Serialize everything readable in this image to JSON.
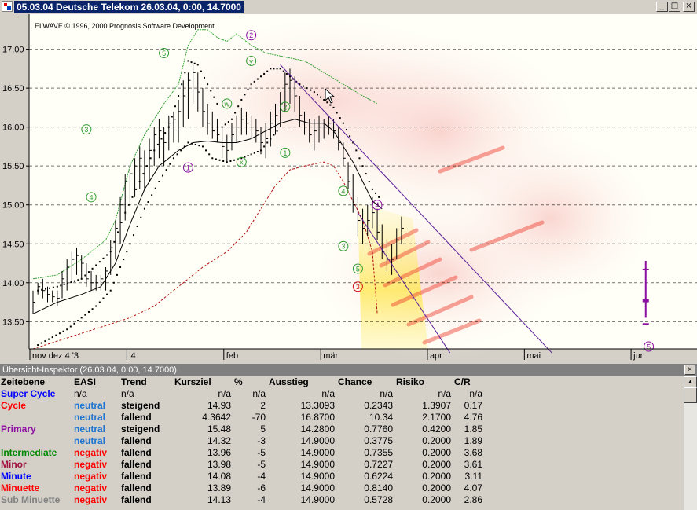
{
  "window": {
    "title": "05.03.04  Deutsche Telekom  26.03.04, 0:00, 14.7000",
    "minimize_glyph": "_",
    "maximize_glyph": "□",
    "close_glyph": "×"
  },
  "chart": {
    "copyright": "ELWAVE © 1996, 2000 Prognosis Software Development",
    "background": "#fffff7",
    "ylim": [
      13.15,
      17.45
    ],
    "y_ticks": [
      "17.00",
      "16.50",
      "16.00",
      "15.50",
      "15.00",
      "14.50",
      "14.00",
      "13.50"
    ],
    "y_tick_values": [
      17.0,
      16.5,
      16.0,
      15.5,
      15.0,
      14.5,
      14.0,
      13.5
    ],
    "x_labels": [
      {
        "label": "nov dez 4 '3",
        "day": 0
      },
      {
        "label": "'4",
        "day": 20
      },
      {
        "label": "feb",
        "day": 40
      },
      {
        "label": "mär",
        "day": 60
      },
      {
        "label": "apr",
        "day": 82
      },
      {
        "label": "mai",
        "day": 102
      },
      {
        "label": "jun",
        "day": 124
      }
    ],
    "candles": [
      [
        13.6,
        13.9,
        13.75
      ],
      [
        13.85,
        14.0,
        13.95
      ],
      [
        13.8,
        14.05,
        13.9
      ],
      [
        13.75,
        13.95,
        13.85
      ],
      [
        13.75,
        13.9,
        13.82
      ],
      [
        13.7,
        13.9,
        13.8
      ],
      [
        13.8,
        14.15,
        14.05
      ],
      [
        13.9,
        14.3,
        14.2
      ],
      [
        14.0,
        14.4,
        14.3
      ],
      [
        14.1,
        14.45,
        14.35
      ],
      [
        14.05,
        14.35,
        14.25
      ],
      [
        13.95,
        14.25,
        14.05
      ],
      [
        13.9,
        14.15,
        14.0
      ],
      [
        13.9,
        14.1,
        14.0
      ],
      [
        13.9,
        14.1,
        14.05
      ],
      [
        13.9,
        14.2,
        14.15
      ],
      [
        14.1,
        14.55,
        14.45
      ],
      [
        14.3,
        14.8,
        14.7
      ],
      [
        14.5,
        15.1,
        15.0
      ],
      [
        14.8,
        15.4,
        15.3
      ],
      [
        15.0,
        15.5,
        15.4
      ],
      [
        15.1,
        15.6,
        15.5
      ],
      [
        15.2,
        15.75,
        15.6
      ],
      [
        15.2,
        15.7,
        15.5
      ],
      [
        15.3,
        15.85,
        15.7
      ],
      [
        15.5,
        16.0,
        15.9
      ],
      [
        15.6,
        16.1,
        15.95
      ],
      [
        15.5,
        16.0,
        15.8
      ],
      [
        15.7,
        16.15,
        16.05
      ],
      [
        15.8,
        16.2,
        16.1
      ],
      [
        15.8,
        16.35,
        16.2
      ],
      [
        16.0,
        16.6,
        16.4
      ],
      [
        16.1,
        16.7,
        16.6
      ],
      [
        16.3,
        16.8,
        16.7
      ],
      [
        16.2,
        16.7,
        16.45
      ],
      [
        16.0,
        16.5,
        16.2
      ],
      [
        15.9,
        16.3,
        16.05
      ],
      [
        15.85,
        16.2,
        15.95
      ],
      [
        15.8,
        16.1,
        15.9
      ],
      [
        15.6,
        16.0,
        15.75
      ],
      [
        15.55,
        15.9,
        15.7
      ],
      [
        15.7,
        16.05,
        15.9
      ],
      [
        15.8,
        16.15,
        16.0
      ],
      [
        15.9,
        16.25,
        16.1
      ],
      [
        15.9,
        16.2,
        16.05
      ],
      [
        15.85,
        16.15,
        16.0
      ],
      [
        15.8,
        16.1,
        15.95
      ],
      [
        15.65,
        16.0,
        15.8
      ],
      [
        15.6,
        16.05,
        15.85
      ],
      [
        15.75,
        16.2,
        16.05
      ],
      [
        15.9,
        16.3,
        16.15
      ],
      [
        16.0,
        16.45,
        16.3
      ],
      [
        16.2,
        16.7,
        16.55
      ],
      [
        16.3,
        16.75,
        16.6
      ],
      [
        16.2,
        16.65,
        16.4
      ],
      [
        16.0,
        16.4,
        16.15
      ],
      [
        15.9,
        16.2,
        16.0
      ],
      [
        15.8,
        16.1,
        15.9
      ],
      [
        15.7,
        16.1,
        15.95
      ],
      [
        15.8,
        16.15,
        16.0
      ],
      [
        15.85,
        16.1,
        16.0
      ],
      [
        15.9,
        16.15,
        16.05
      ],
      [
        15.85,
        16.1,
        15.95
      ],
      [
        15.7,
        16.0,
        15.8
      ],
      [
        15.5,
        15.8,
        15.6
      ],
      [
        15.2,
        15.55,
        15.3
      ],
      [
        14.9,
        15.4,
        15.0
      ],
      [
        14.6,
        15.1,
        14.8
      ],
      [
        14.5,
        14.95,
        14.7
      ],
      [
        14.6,
        15.0,
        14.8
      ],
      [
        14.7,
        15.1,
        14.9
      ],
      [
        14.55,
        14.95,
        14.65
      ],
      [
        14.3,
        14.75,
        14.4
      ],
      [
        14.15,
        14.55,
        14.3
      ],
      [
        14.1,
        14.5,
        14.3
      ],
      [
        14.3,
        14.7,
        14.55
      ],
      [
        14.5,
        14.85,
        14.7
      ]
    ],
    "upper_envelope": [
      [
        0,
        14.05
      ],
      [
        5,
        14.1
      ],
      [
        10,
        14.3
      ],
      [
        15,
        14.55
      ],
      [
        17,
        14.8
      ],
      [
        20,
        15.5
      ],
      [
        23,
        15.9
      ],
      [
        27,
        16.3
      ],
      [
        30,
        16.55
      ],
      [
        32,
        17.05
      ],
      [
        34,
        17.25
      ],
      [
        36,
        17.25
      ],
      [
        38,
        17.15
      ],
      [
        40,
        17.1
      ],
      [
        42,
        17.2
      ],
      [
        45,
        17.05
      ],
      [
        48,
        16.95
      ],
      [
        52,
        16.9
      ],
      [
        56,
        16.85
      ],
      [
        60,
        16.7
      ],
      [
        64,
        16.55
      ],
      [
        68,
        16.4
      ],
      [
        71,
        16.3
      ]
    ],
    "lower_envelope": [
      [
        0,
        13.15
      ],
      [
        5,
        13.25
      ],
      [
        10,
        13.35
      ],
      [
        15,
        13.45
      ],
      [
        20,
        13.55
      ],
      [
        25,
        13.7
      ],
      [
        30,
        13.95
      ],
      [
        35,
        14.2
      ],
      [
        40,
        14.4
      ],
      [
        44,
        14.65
      ],
      [
        47,
        14.95
      ],
      [
        50,
        15.25
      ],
      [
        53,
        15.45
      ],
      [
        56,
        15.5
      ],
      [
        60,
        15.55
      ],
      [
        62,
        15.5
      ],
      [
        64,
        15.3
      ],
      [
        66,
        15.05
      ],
      [
        68,
        14.8
      ],
      [
        70,
        14.4
      ],
      [
        71,
        13.6
      ]
    ],
    "moving_average": [
      [
        0,
        13.6
      ],
      [
        5,
        13.75
      ],
      [
        10,
        13.85
      ],
      [
        14,
        13.95
      ],
      [
        17,
        14.25
      ],
      [
        20,
        14.75
      ],
      [
        23,
        15.2
      ],
      [
        26,
        15.5
      ],
      [
        30,
        15.7
      ],
      [
        33,
        15.8
      ],
      [
        36,
        15.82
      ],
      [
        39,
        15.8
      ],
      [
        42,
        15.8
      ],
      [
        45,
        15.85
      ],
      [
        48,
        15.95
      ],
      [
        51,
        16.05
      ],
      [
        54,
        16.1
      ],
      [
        57,
        16.05
      ],
      [
        60,
        16.05
      ],
      [
        62,
        15.95
      ],
      [
        64,
        15.75
      ],
      [
        66,
        15.55
      ],
      [
        68,
        15.3
      ],
      [
        70,
        15.05
      ],
      [
        72,
        14.95
      ]
    ],
    "dotted_upper": [
      [
        1,
        13.9
      ],
      [
        5,
        13.95
      ],
      [
        10,
        14.05
      ],
      [
        16,
        14.4
      ],
      [
        19,
        14.9
      ],
      [
        22,
        15.3
      ],
      [
        25,
        15.7
      ],
      [
        28,
        16.0
      ],
      [
        30,
        16.4
      ],
      [
        32,
        16.85
      ],
      [
        34,
        16.8
      ],
      [
        36,
        16.55
      ],
      [
        38,
        16.3
      ],
      [
        39,
        16.0
      ],
      [
        41,
        16.1
      ],
      [
        43,
        16.35
      ],
      [
        45,
        16.55
      ],
      [
        47,
        16.65
      ],
      [
        49,
        16.75
      ],
      [
        51,
        16.75
      ],
      [
        53,
        16.65
      ],
      [
        55,
        16.55
      ],
      [
        58,
        16.45
      ],
      [
        60,
        16.35
      ],
      [
        62,
        16.25
      ],
      [
        64,
        16.05
      ],
      [
        66,
        15.8
      ],
      [
        68,
        15.5
      ],
      [
        70,
        15.2
      ],
      [
        72,
        15.05
      ]
    ],
    "dotted_lower": [
      [
        1,
        13.2
      ],
      [
        4,
        13.3
      ],
      [
        7,
        13.4
      ],
      [
        10,
        13.55
      ],
      [
        13,
        13.7
      ],
      [
        16,
        13.9
      ],
      [
        18,
        14.2
      ],
      [
        20,
        14.5
      ],
      [
        23,
        14.95
      ],
      [
        26,
        15.3
      ],
      [
        29,
        15.6
      ],
      [
        32,
        15.8
      ],
      [
        35,
        15.75
      ],
      [
        37,
        15.6
      ],
      [
        40,
        15.55
      ],
      [
        43,
        15.6
      ],
      [
        45,
        15.65
      ],
      [
        47,
        15.7
      ],
      [
        49,
        15.85
      ],
      [
        51,
        16.0
      ]
    ],
    "channel": {
      "upper": [
        [
          51,
          16.8
        ],
        [
          107,
          13.1
        ]
      ],
      "lower": [
        [
          67,
          14.9
        ],
        [
          86,
          13.1
        ]
      ]
    },
    "wave_labels": [
      {
        "text": "3",
        "day": 11,
        "value": 15.97,
        "color": "#2e9a2e"
      },
      {
        "text": "4",
        "day": 12,
        "value": 15.1,
        "color": "#2e9a2e"
      },
      {
        "text": "5",
        "day": 27,
        "value": 16.95,
        "color": "#2e9a2e"
      },
      {
        "text": "1",
        "day": 32,
        "value": 15.48,
        "color": "#8b0fa0"
      },
      {
        "text": "w",
        "day": 40,
        "value": 16.3,
        "color": "#2e9a2e"
      },
      {
        "text": "x",
        "day": 43,
        "value": 15.55,
        "color": "#2e9a2e"
      },
      {
        "text": "y",
        "day": 45,
        "value": 16.85,
        "color": "#2e9a2e"
      },
      {
        "text": "2",
        "day": 45,
        "value": 17.18,
        "color": "#8b0fa0"
      },
      {
        "text": "2",
        "day": 52,
        "value": 16.26,
        "color": "#2e9a2e"
      },
      {
        "text": "1",
        "day": 52,
        "value": 15.67,
        "color": "#2e9a2e"
      },
      {
        "text": "4",
        "day": 64,
        "value": 15.18,
        "color": "#2e9a2e"
      },
      {
        "text": "3",
        "day": 64,
        "value": 14.47,
        "color": "#2e9a2e"
      },
      {
        "text": "5",
        "day": 67,
        "value": 14.18,
        "color": "#2e9a2e"
      },
      {
        "text": "3",
        "day": 67,
        "value": 13.95,
        "color": "#d01010"
      },
      {
        "text": "4",
        "day": 71,
        "value": 15.0,
        "color": "#8b0fa0"
      },
      {
        "text": "5",
        "day": 127,
        "value": 13.18,
        "color": "#8b0fa0"
      }
    ],
    "target_bar": {
      "day": 128,
      "top": 14.28,
      "bottom": 13.55,
      "ticks": [
        14.17,
        13.77,
        13.47
      ],
      "color": "#8b0fa0"
    }
  },
  "inspector": {
    "title": "Übersicht-Inspektor (26.03.04, 0:00, 14.7000)",
    "close_glyph": "×",
    "columns": [
      "Zeitebene",
      "EASI",
      "Trend",
      "Kursziel",
      "%",
      "Ausstieg",
      "Chance",
      "Risiko",
      "C/R"
    ],
    "rows": [
      {
        "label": "Super Cycle",
        "label_color": "#0000ff",
        "easi": "n/a",
        "easi_color": "#000000",
        "trend": "n/a",
        "kursziel": "n/a",
        "pct": "n/a",
        "ausstieg": "n/a",
        "chance": "n/a",
        "risiko": "n/a",
        "cr": "n/a"
      },
      {
        "label": "Cycle",
        "label_color": "#ff0000",
        "easi": "neutral",
        "easi_color": "#1e74d0",
        "trend": "steigend",
        "kursziel": "14.93",
        "pct": "2",
        "ausstieg": "13.3093",
        "chance": "0.2343",
        "risiko": "1.3907",
        "cr": "0.17"
      },
      {
        "label": "",
        "label_color": "#000000",
        "easi": "neutral",
        "easi_color": "#1e74d0",
        "trend": "fallend",
        "kursziel": "4.3642",
        "pct": "-70",
        "ausstieg": "16.8700",
        "chance": "10.34",
        "risiko": "2.1700",
        "cr": "4.76"
      },
      {
        "label": "Primary",
        "label_color": "#8b0fa0",
        "easi": "neutral",
        "easi_color": "#1e74d0",
        "trend": "steigend",
        "kursziel": "15.48",
        "pct": "5",
        "ausstieg": "14.2800",
        "chance": "0.7760",
        "risiko": "0.4200",
        "cr": "1.85"
      },
      {
        "label": "",
        "label_color": "#000000",
        "easi": "neutral",
        "easi_color": "#1e74d0",
        "trend": "fallend",
        "kursziel": "14.32",
        "pct": "-3",
        "ausstieg": "14.9000",
        "chance": "0.3775",
        "risiko": "0.2000",
        "cr": "1.89"
      },
      {
        "label": "Intermediate",
        "label_color": "#008800",
        "easi": "negativ",
        "easi_color": "#ff0000",
        "trend": "fallend",
        "kursziel": "13.96",
        "pct": "-5",
        "ausstieg": "14.9000",
        "chance": "0.7355",
        "risiko": "0.2000",
        "cr": "3.68"
      },
      {
        "label": "Minor",
        "label_color": "#a01040",
        "easi": "negativ",
        "easi_color": "#ff0000",
        "trend": "fallend",
        "kursziel": "13.98",
        "pct": "-5",
        "ausstieg": "14.9000",
        "chance": "0.7227",
        "risiko": "0.2000",
        "cr": "3.61"
      },
      {
        "label": "Minute",
        "label_color": "#0000ff",
        "easi": "negativ",
        "easi_color": "#ff0000",
        "trend": "fallend",
        "kursziel": "14.08",
        "pct": "-4",
        "ausstieg": "14.9000",
        "chance": "0.6224",
        "risiko": "0.2000",
        "cr": "3.11"
      },
      {
        "label": "Minuette",
        "label_color": "#ff0000",
        "easi": "negativ",
        "easi_color": "#ff0000",
        "trend": "fallend",
        "kursziel": "13.89",
        "pct": "-6",
        "ausstieg": "14.9000",
        "chance": "0.8140",
        "risiko": "0.2000",
        "cr": "4.07"
      },
      {
        "label": "Sub Minuette",
        "label_color": "#808080",
        "easi": "negativ",
        "easi_color": "#ff0000",
        "trend": "fallend",
        "kursziel": "14.13",
        "pct": "-4",
        "ausstieg": "14.9000",
        "chance": "0.5728",
        "risiko": "0.2000",
        "cr": "2.86"
      }
    ]
  }
}
